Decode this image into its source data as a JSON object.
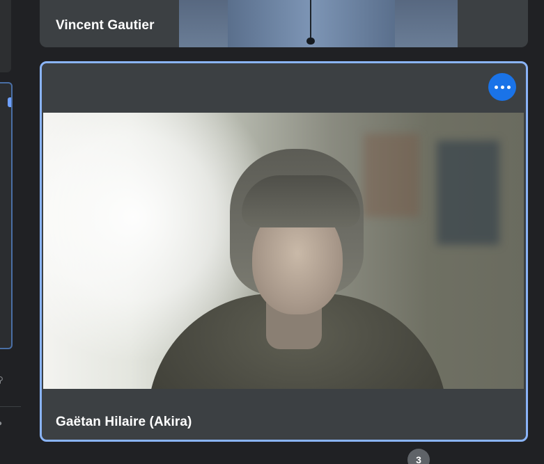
{
  "tiles": [
    {
      "participant_name": "Vincent Gautier"
    },
    {
      "participant_name": "Gaëtan Hilaire (Akira)",
      "active_speaker": true
    }
  ],
  "controls": {
    "more_options_icon": "more-horiz-icon"
  },
  "badge": {
    "participant_count": "3"
  },
  "colors": {
    "background": "#202124",
    "tile": "#3c4043",
    "active_border": "#8ab4f8",
    "accent": "#1a73e8",
    "badge": "#5f6368"
  }
}
